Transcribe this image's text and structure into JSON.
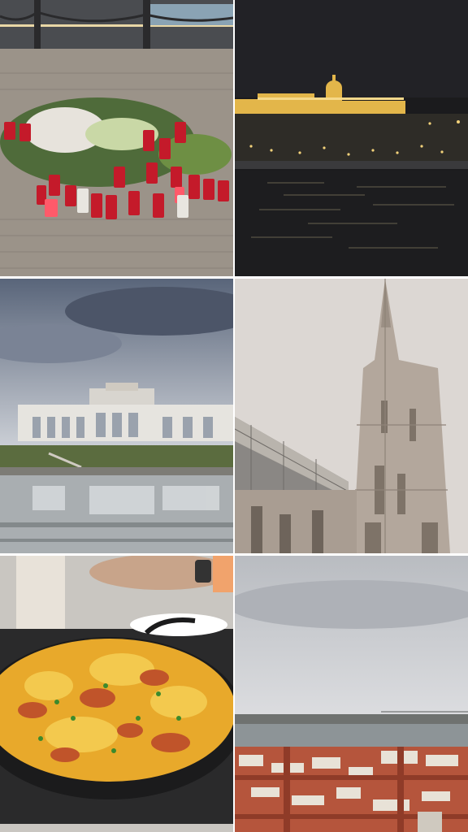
{
  "collage": {
    "layout": "3x2 grid",
    "tiles": [
      {
        "position": "top-left",
        "subject": "candles-memorial"
      },
      {
        "position": "top-right",
        "subject": "illuminated-palace-by-river-at-night"
      },
      {
        "position": "middle-left",
        "subject": "colonnade-pavilion-with-reflecting-pond"
      },
      {
        "position": "middle-right",
        "subject": "gothic-cathedral-spire"
      },
      {
        "position": "bottom-left",
        "subject": "paella-pan"
      },
      {
        "position": "bottom-right",
        "subject": "city-rooftops-and-river-view"
      }
    ]
  },
  "colors": {
    "candle_red": "#c41a2a",
    "night_sky": "#1b1b1d",
    "palace_gold": "#e3b64a",
    "overcast_sky": "#c9cdd4",
    "stone": "#b9b2a9",
    "paella_yellow": "#e8a92b",
    "roof_terracotta": "#b5553c"
  }
}
